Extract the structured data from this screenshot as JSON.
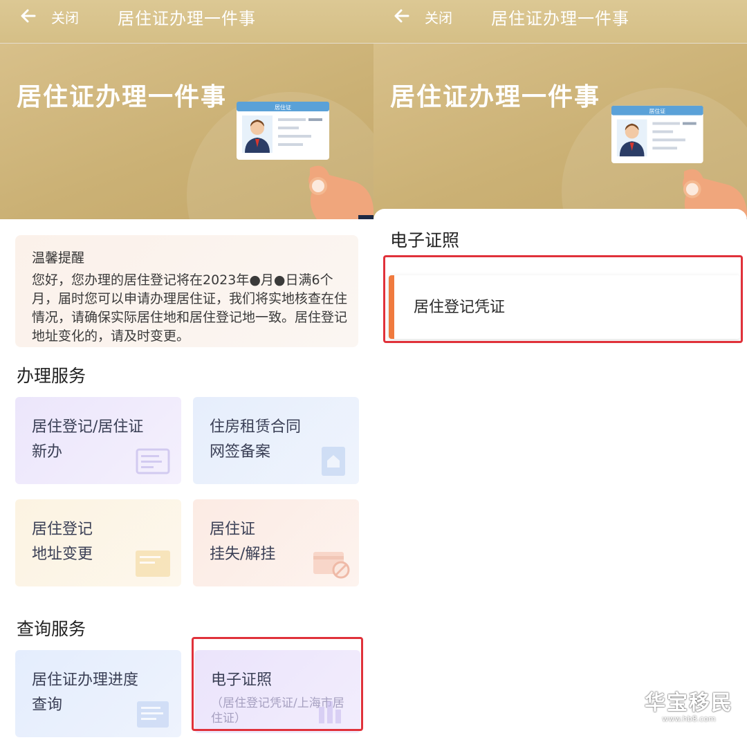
{
  "header": {
    "close_label": "关闭",
    "title": "居住证办理一件事"
  },
  "banner": {
    "title": "居住证办理一件事",
    "card_label": "居住证"
  },
  "notice": {
    "title": "温馨提醒",
    "body": "您好，您办理的居住登记将在2023年●月●日满6个月，届时您可以申请办理居住证，我们将实地核查在住情况，请确保实际居住地和居住登记地一致。居住登记地址变化的，请及时变更。"
  },
  "services": {
    "title": "办理服务",
    "items": [
      {
        "line1": "居住登记/居住证",
        "line2": "新办"
      },
      {
        "line1": "住房租赁合同",
        "line2": "网签备案"
      },
      {
        "line1": "居住登记",
        "line2": "地址变更"
      },
      {
        "line1": "居住证",
        "line2": "挂失/解挂"
      }
    ]
  },
  "query": {
    "title": "查询服务",
    "items": [
      {
        "line1": "居住证办理进度",
        "line2": "查询"
      },
      {
        "line1": "电子证照",
        "sub": "（居住登记凭证/上海市居住证）"
      }
    ]
  },
  "sheet": {
    "title": "电子证照",
    "items": [
      {
        "label": "居住登记凭证"
      }
    ]
  },
  "watermark": {
    "text": "华宝移民",
    "url": "www.hb8.com"
  },
  "colors": {
    "banner": "#cbb175",
    "highlight": "#e0313a",
    "accent_bar": "#f07a3e"
  },
  "icons": [
    "back-arrow-icon",
    "id-card-hand-illustration"
  ]
}
